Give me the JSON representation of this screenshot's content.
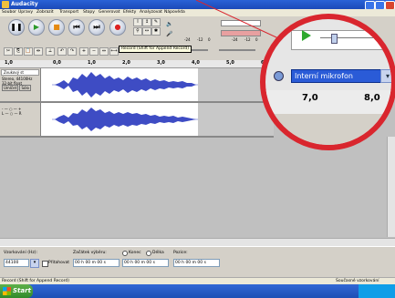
{
  "window": {
    "title": "Audacity"
  },
  "menu": [
    "Soubor",
    "Úpravy",
    "Zobrazit",
    "Transport",
    "Stopy",
    "Generovat",
    "Efekty",
    "Analyzovat",
    "Nápověda"
  ],
  "tooltip": "Record (Shift for Append Record)",
  "meter_ticks": [
    "-24",
    "-12",
    "0",
    "-24",
    "-12",
    "0"
  ],
  "ruler": [
    "1,0",
    "0,0",
    "1,0",
    "2,0",
    "3,0",
    "4,0",
    "5,0",
    "6,0"
  ],
  "tracks": [
    {
      "name": "Zvukový st",
      "info1": "Stereo, 44100Hz",
      "info2": "32-bit float",
      "mute": "Umlčet",
      "solo": "Sólo",
      "scale": [
        "1,0",
        "0,0",
        "-1,0"
      ]
    },
    {
      "scale": [
        "1,0",
        "0,0",
        "-1,0"
      ]
    }
  ],
  "bottom": {
    "rate_label": "Vzorkování (Hz):",
    "rate_value": "44100",
    "snap_label": "Přitahovat",
    "start_label": "Začátek výběru:",
    "end_label": "Konec",
    "length_label": "Délka",
    "position_label": "Pozice:",
    "time_value": "00 h 00 m 00 s"
  },
  "status": {
    "left": "Record (Shift for Append Record)",
    "right": "Současné vzorkování"
  },
  "taskbar": {
    "start": "Start"
  },
  "zoom": {
    "device": "Interní mikrofon",
    "ruler": [
      "7,0",
      "8,0"
    ]
  }
}
